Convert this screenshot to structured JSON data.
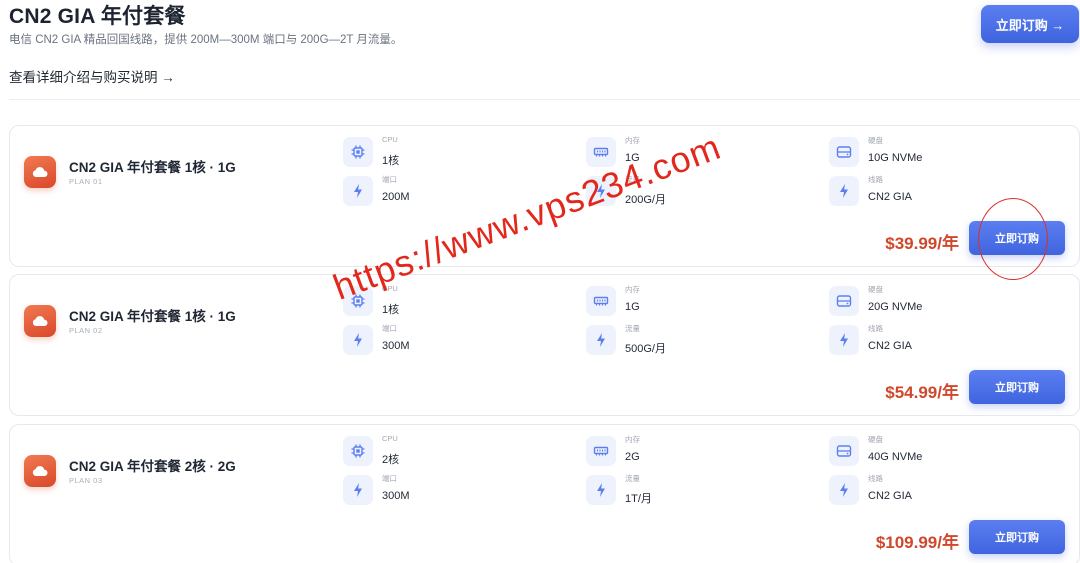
{
  "header": {
    "title": "CN2 GIA 年付套餐",
    "subtitle": "电信 CN2 GIA 精品回国线路，提供 200M—300M 端口与 200G—2T 月流量。",
    "details_link": "查看详细介绍与购买说明 →",
    "order_label": "立即订购 →"
  },
  "plans": [
    {
      "name": "CN2 GIA 年付套餐 1核 · 1G",
      "code": "PLAN 01",
      "cpu_label": "CPU",
      "cpu": "1核",
      "ram_label": "内存",
      "ram": "1G",
      "disk_label": "硬盘",
      "disk": "10G NVMe",
      "port_label": "端口",
      "port": "200M",
      "traffic_label": "流量",
      "traffic": "200G/月",
      "line_label": "线路",
      "line": "CN2 GIA",
      "price": "$39.99/年",
      "order_label": "立即订购"
    },
    {
      "name": "CN2 GIA 年付套餐 1核 · 1G",
      "code": "PLAN 02",
      "cpu_label": "CPU",
      "cpu": "1核",
      "ram_label": "内存",
      "ram": "1G",
      "disk_label": "硬盘",
      "disk": "20G NVMe",
      "port_label": "端口",
      "port": "300M",
      "traffic_label": "流量",
      "traffic": "500G/月",
      "line_label": "线路",
      "line": "CN2 GIA",
      "price": "$54.99/年",
      "order_label": "立即订购"
    },
    {
      "name": "CN2 GIA 年付套餐 2核 · 2G",
      "code": "PLAN 03",
      "cpu_label": "CPU",
      "cpu": "2核",
      "ram_label": "内存",
      "ram": "2G",
      "disk_label": "硬盘",
      "disk": "40G NVMe",
      "port_label": "端口",
      "port": "300M",
      "traffic_label": "流量",
      "traffic": "1T/月",
      "line_label": "线路",
      "line": "CN2 GIA",
      "price": "$109.99/年",
      "order_label": "立即订购"
    }
  ],
  "watermark": "https://www.vps234.com",
  "icons": {
    "plan": "cloud-icon",
    "cpu": "cpu-chip-icon",
    "ram": "memory-icon",
    "disk": "disk-icon",
    "port": "lightning-icon",
    "traffic": "lightning-icon",
    "line": "lightning-icon"
  },
  "colors": {
    "accent": "#4a6ee6",
    "price": "#d0482c",
    "plan_icon": "#e35c37",
    "icon_tint": "#5b7ff0",
    "watermark": "#e2281c"
  }
}
